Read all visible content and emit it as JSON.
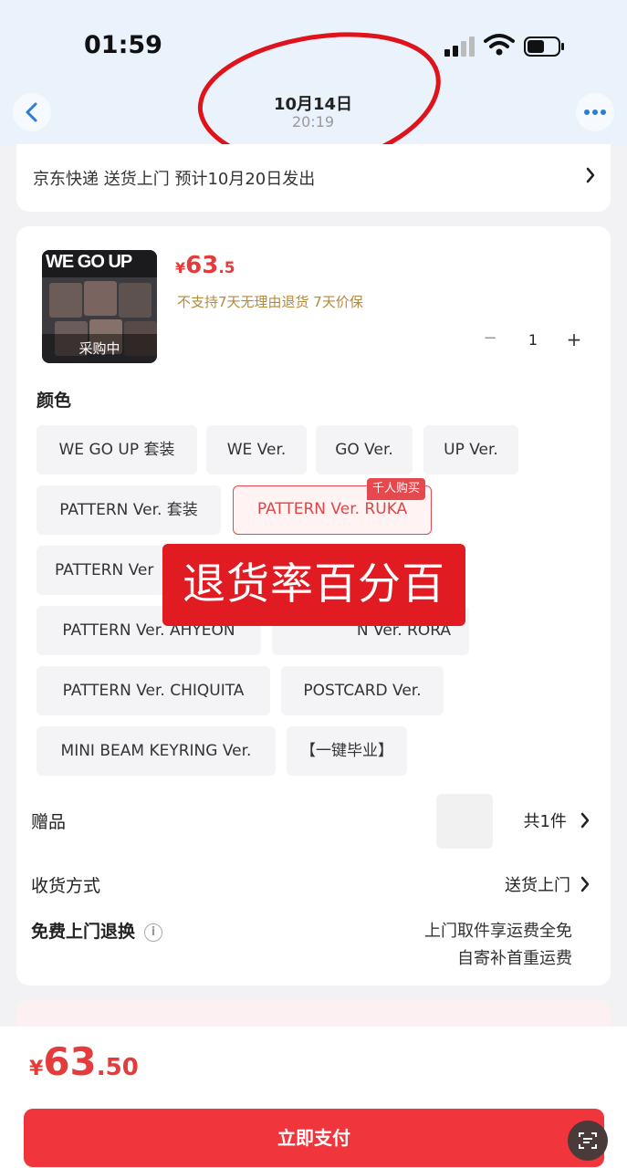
{
  "status_bar": {
    "time": "01:59"
  },
  "nav": {
    "date": "10月14日",
    "time": "20:19"
  },
  "shipping": {
    "text": "京东快递 送货上门 预计10月20日发出"
  },
  "product": {
    "image_brand_text": "WE GO UP",
    "image_tag": "采购中",
    "price_symbol": "¥",
    "price_int": "63",
    "price_dec": ".5",
    "policy": "不支持7天无理由退货  7天价保",
    "quantity": "1",
    "minus": "−",
    "plus": "+"
  },
  "color_section": {
    "label": "颜色",
    "options": [
      "WE GO UP 套装",
      "WE Ver.",
      "GO Ver.",
      "UP Ver.",
      "PATTERN Ver. 套装",
      "PATTERN Ver. RUKA",
      "PATTERN Ver",
      "PATTERN Ver. AHYEON",
      "N Ver. RORA",
      "PATTERN Ver. CHIQUITA",
      "POSTCARD Ver.",
      "MINI BEAM KEYRING Ver.",
      "【一键毕业】"
    ],
    "selected_badge": "千人购买"
  },
  "overlay_text": "退货率百分百",
  "gift": {
    "label": "赠品",
    "value": "共1件"
  },
  "delivery": {
    "label": "收货方式",
    "value": "送货上门"
  },
  "return": {
    "label": "免费上门退换",
    "info": "i",
    "line1": "上门取件享运费全免",
    "line2": "自寄补首重运费"
  },
  "bottom": {
    "price_symbol": "¥",
    "price_int": "63",
    "price_dec": ".50",
    "pay_label": "立即支付"
  },
  "colors": {
    "accent": "#e5484d",
    "pay": "#f0353c",
    "price": "#e43b3b",
    "policy": "#b4893a",
    "circle": "#e0121b"
  }
}
